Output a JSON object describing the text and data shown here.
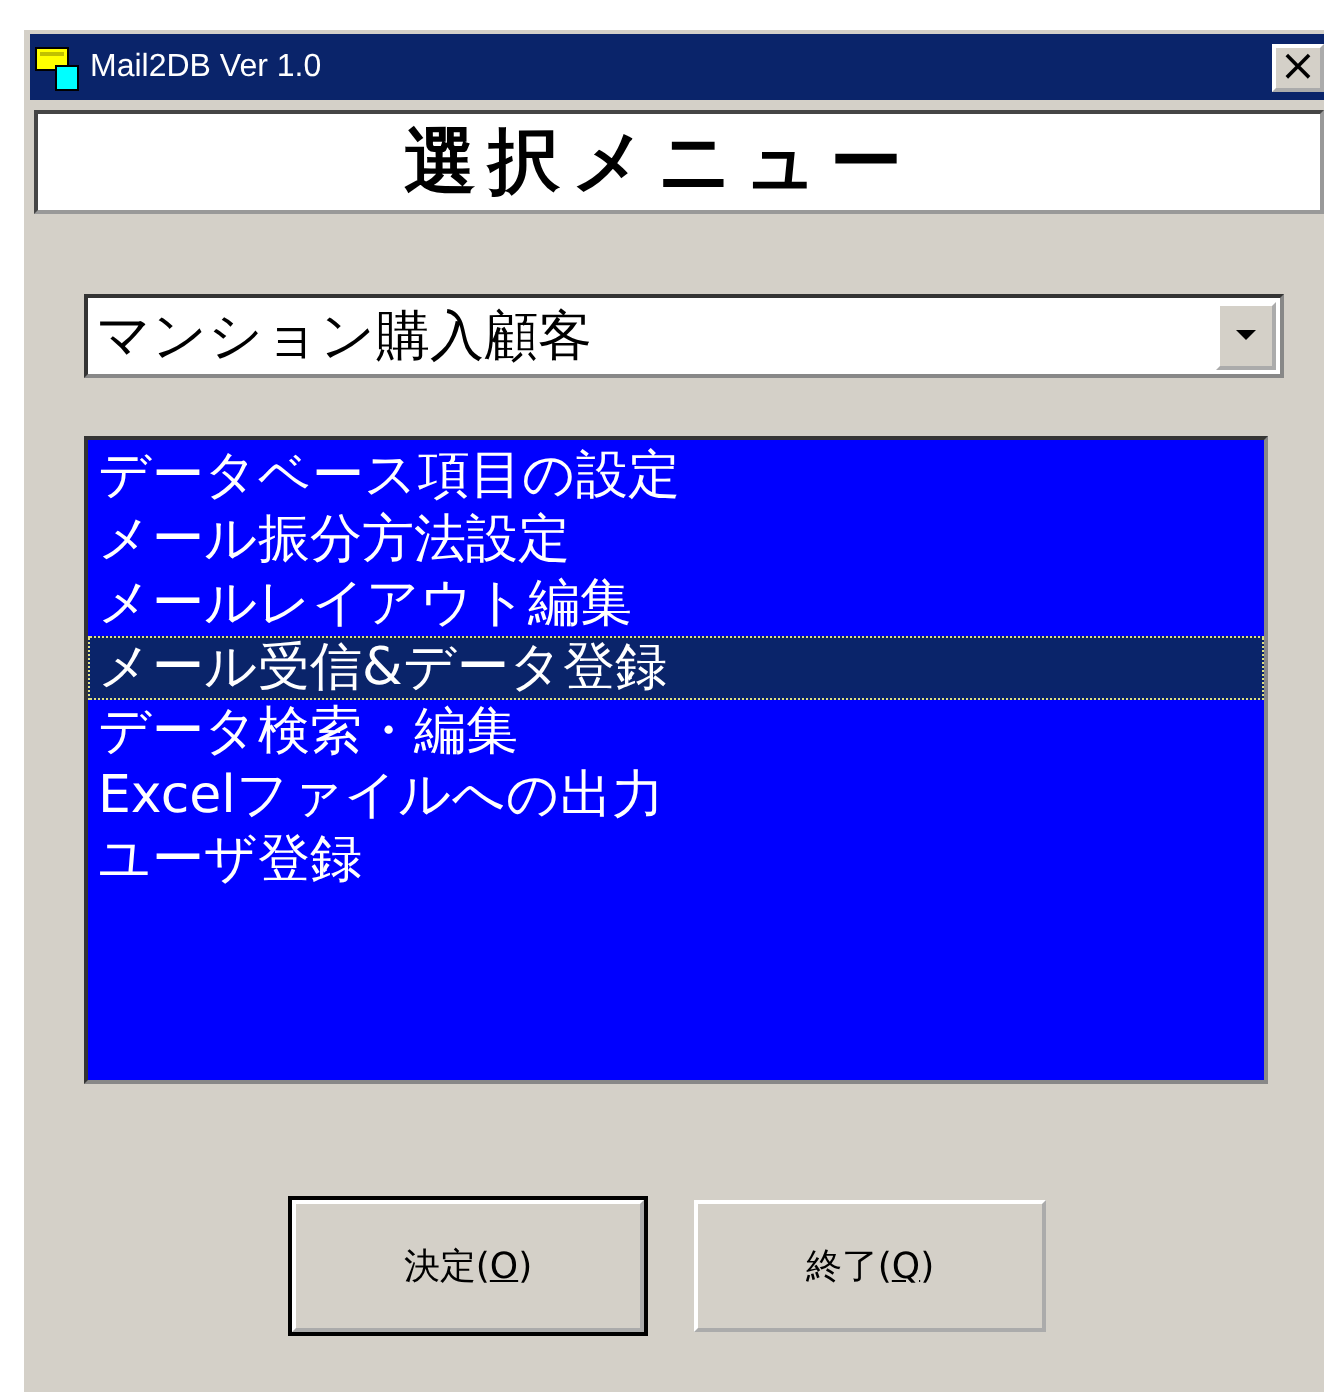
{
  "window": {
    "title": "Mail2DB Ver 1.0",
    "close_glyph": "×"
  },
  "heading": "選択メニュー",
  "combo": {
    "value": "マンション購入顧客"
  },
  "menu_list": [
    {
      "label": "データベース項目の設定",
      "selected": false
    },
    {
      "label": "メール振分方法設定",
      "selected": false
    },
    {
      "label": "メールレイアウト編集",
      "selected": false
    },
    {
      "label": "メール受信&データ登録",
      "selected": true
    },
    {
      "label": "データ検索・編集",
      "selected": false
    },
    {
      "label": "Excelファイルへの出力",
      "selected": false
    },
    {
      "label": "ユーザ登録",
      "selected": false
    }
  ],
  "buttons": [
    {
      "before": "決定(",
      "mnemonic": "O",
      "after": ")",
      "default": true
    },
    {
      "before": "終了(",
      "mnemonic": "Q",
      "after": ")",
      "default": false
    }
  ]
}
